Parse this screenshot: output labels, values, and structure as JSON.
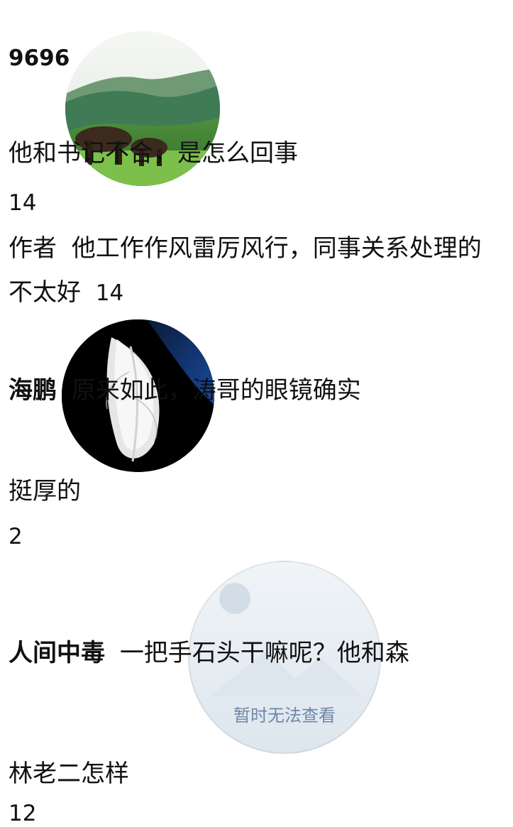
{
  "comments": [
    {
      "name": "9696",
      "text_line1": "他和书记不合，是怎么回事",
      "likes": "14"
    },
    {
      "prefix": "作者",
      "text_line1": "他工作作风雷厉风行，同事关系处理的",
      "text_line2": "不太好",
      "likes": "14"
    },
    {
      "name": "海鹏",
      "text_line1": "原来如此，涛哥的眼镜确实",
      "text_line2": "挺厚的",
      "likes": "2"
    },
    {
      "name": "人间中毒",
      "text_line1": "一把手石头干嘛呢？他和森",
      "text_line2": "林老二怎样",
      "likes": "12"
    }
  ],
  "placeholder": {
    "label": "暂时无法查看"
  },
  "colors": {
    "text": "#111111",
    "placeholder_text": "#6f86a6"
  },
  "icons": {
    "avatar_1": "landscape-photo-icon",
    "avatar_2": "feather-photo-icon",
    "avatar_3": "image-placeholder-icon"
  }
}
